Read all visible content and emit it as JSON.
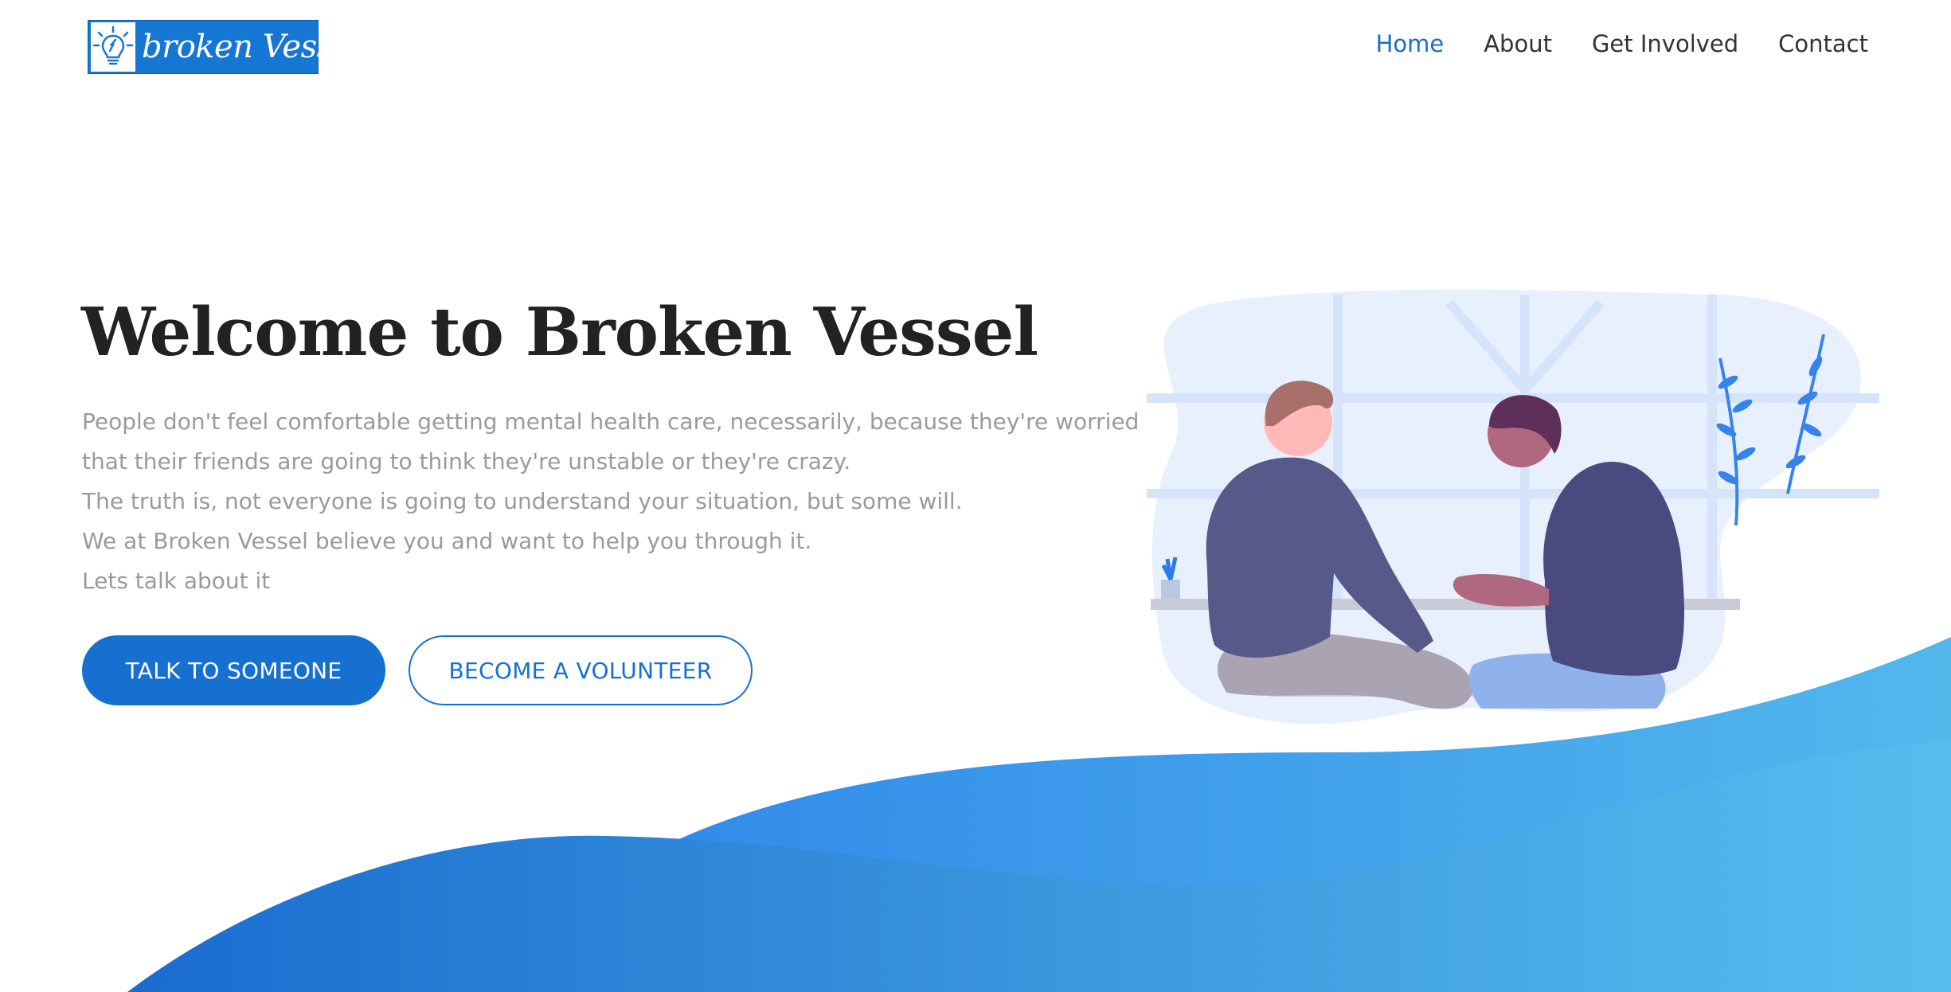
{
  "header": {
    "logo_text": "broken Vessel",
    "logo_icon": "lightbulb-icon",
    "nav": [
      {
        "label": "Home",
        "active": true
      },
      {
        "label": "About",
        "active": false
      },
      {
        "label": "Get Involved",
        "active": false
      },
      {
        "label": "Contact",
        "active": false
      }
    ]
  },
  "hero": {
    "title": "Welcome to Broken Vessel",
    "paragraphs": [
      "People don't feel comfortable getting mental health care, necessarily, because they're worried",
      "that their friends are going to think they're unstable or they're crazy.",
      "The truth is, not everyone is going to understand your situation, but some will.",
      "We at Broken Vessel believe you and want to help you through it.",
      "Lets talk about it"
    ],
    "primary_button": "TALK TO SOMEONE",
    "secondary_button": "BECOME A VOLUNTEER"
  },
  "colors": {
    "accent": "#1670d0",
    "text_dark": "#222222",
    "text_muted": "#9a9a9a",
    "wave_start": "#1f6fd0",
    "wave_end": "#52b8ec"
  }
}
